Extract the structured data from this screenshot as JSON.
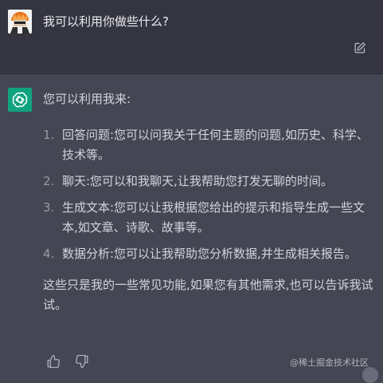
{
  "user_message": {
    "text": "我可以利用你做些什么?",
    "avatar_icon": "user-avatar",
    "edit_icon": "edit-icon"
  },
  "assistant_message": {
    "intro": "您可以利用我来:",
    "items": [
      {
        "num": "1.",
        "text": "回答问题:您可以问我关于任何主题的问题,如历史、科学、技术等。"
      },
      {
        "num": "2.",
        "text": "聊天:您可以和我聊天,让我帮助您打发无聊的时间。"
      },
      {
        "num": "3.",
        "text": "生成文本:您可以让我根据您给出的提示和指导生成一些文本,如文章、诗歌、故事等。"
      },
      {
        "num": "4.",
        "text": "数据分析:您可以让我帮助您分析数据,并生成相关报告。"
      }
    ],
    "closing": "这些只是我的一些常见功能,如果您有其他需求,也可以告诉我试试。",
    "avatar_color": "#10a37f"
  },
  "actions": {
    "thumbs_up_icon": "thumbs-up-icon",
    "thumbs_down_icon": "thumbs-down-icon"
  },
  "watermark": "@稀土掘金技术社区",
  "colors": {
    "user_bg": "#343541",
    "assistant_bg": "#444654",
    "accent": "#10a37f"
  }
}
